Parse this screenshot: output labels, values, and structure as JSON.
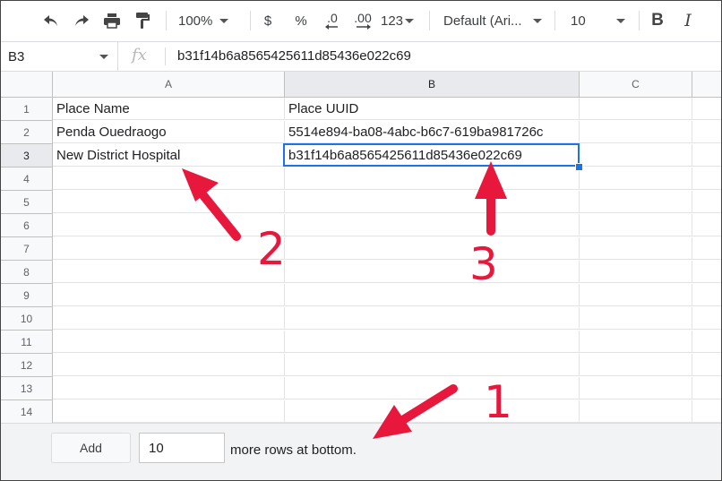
{
  "toolbar": {
    "zoom": "100%",
    "currency": "$",
    "percent": "%",
    "decrease_decimals": ".0",
    "increase_decimals": ".00",
    "more_formats": "123",
    "font_family": "Default (Ari...",
    "font_size": "10",
    "bold": "B",
    "italic": "I"
  },
  "formula_bar": {
    "name_box": "B3",
    "fx": "fx",
    "value": "b31f14b6a8565425611d85436e022c69"
  },
  "columns": [
    "A",
    "B",
    "C"
  ],
  "rows": [
    "1",
    "2",
    "3",
    "4",
    "5",
    "6",
    "7",
    "8",
    "9",
    "10",
    "11",
    "12",
    "13",
    "14"
  ],
  "cells": {
    "A1": "Place Name",
    "B1": "Place UUID",
    "A2": "Penda Ouedraogo",
    "B2": "5514e894-ba08-4abc-b6c7-619ba981726c",
    "A3": "New District Hospital",
    "B3": "b31f14b6a8565425611d85436e022c69"
  },
  "selected_cell": "B3",
  "bottom_panel": {
    "add_label": "Add",
    "rows_value": "10",
    "suffix": "more rows at bottom."
  },
  "annotations": [
    {
      "label": "1",
      "color": "#e8173c"
    },
    {
      "label": "2",
      "color": "#e8173c"
    },
    {
      "label": "3",
      "color": "#e8173c"
    }
  ]
}
